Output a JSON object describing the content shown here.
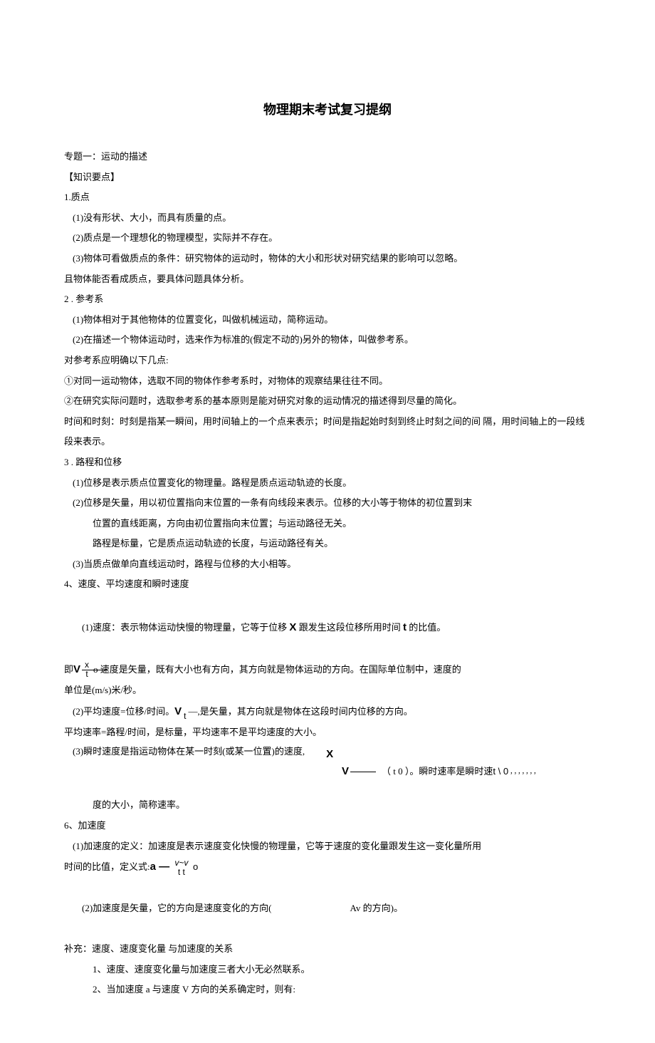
{
  "title": "物理期末考试复习提纲",
  "lines": {
    "l01": "专题一：运动的描述",
    "l02": "【知识要点】",
    "l03": "1.质点",
    "l04": "(1)没有形状、大小，而具有质量的点。",
    "l05": "(2)质点是一个理想化的物理模型，实际并不存在。",
    "l06": "(3)物体可看做质点的条件：研究物体的运动时，物体的大小和形状对研究结果的影响可以忽略。",
    "l07": "且物体能否看成质点，要具体问题具体分析。",
    "l08": "2 . 参考系",
    "l09": "(1)物体相对于其他物体的位置变化，叫做机械运动，简称运动。",
    "l10": "(2)在描述一个物体运动时，选来作为标准的(假定不动的)另外的物体，叫做参考系。",
    "l11": "对参考系应明确以下几点:",
    "l12": "①对同一运动物体，选取不同的物体作参考系时，对物体的观察结果往往不同。",
    "l13": "②在研究实际问题时，选取参考系的基本原则是能对研究对象的运动情况的描述得到尽量的简化。",
    "l14": "时间和时刻：时刻是指某一瞬间，用时间轴上的一个点来表示；时间是指起始时刻到终止时刻之间的间 隔，用时间轴上的一段线段来表示。",
    "l15": "3 . 路程和位移",
    "l16": "(1)位移是表示质点位置变化的物理量。路程是质点运动轨迹的长度。",
    "l17": "(2)位移是矢量，用以初位置指向末位置的一条有向线段来表示。位移的大小等于物体的初位置到末",
    "l18": "位置的直线距离，方向由初位置指向末位置；与运动路径无关。",
    "l19": "路程是标量，它是质点运动轨迹的长度，与运动路径有关。",
    "l20": "(3)当质点做单向直线运动时，路程与位移的大小相等。",
    "l21": "4、速度、平均速度和瞬时速度",
    "l22a": "(1)速度：表示物体运动快慢的物理量，它等于位移 ",
    "l22b": " 跟发生这段位移所用时间 ",
    "l22c": " 的比值。",
    "X": "X",
    "t": "t",
    "l23a": "即 ",
    "l23b": "o 速度是矢量，既有大小也有方向，其方向就是物体运动的方向。在国际单位制中，速度的",
    "frac1num": "x",
    "frac1den": "t",
    "l24": "单位是(m/s)米/秒。",
    "l25a": "(2)平均速度=位移/时间。",
    "l25b": " —,是矢量，其方向就是物体在这段时间内位移的方向。",
    "l25den": "t",
    "l26": "平均速率=路程/时间，是标量，平均速率不是平均速度的大小。",
    "l27a": "(3)瞬时速度是指运动物体在某一时刻(或某一位置)的速度,",
    "l27x": "X",
    "l27b": "（ t 0 ）。瞬时速率是瞬时速 ",
    "l27c": " t \\ 0",
    "dots": "，，，，，，，",
    "l28": "度的大小，简称速率。",
    "l29": "6、加速度",
    "l30": "(1)加速度的定义：加速度是表示速度变化快慢的物理量，它等于速度的变化量跟发生这一变化量所用",
    "l31a": "时间的比值，定义式: ",
    "l31b": "a — ",
    "l31c": "v~v ",
    "l31d": "o",
    "l31den": "t t",
    "l32a": "(2)加速度是矢量，它的方向是速度变化的方向(",
    "l32b": "Av 的方向)。",
    "l33": "补充：速度、速度变化量 与加速度的关系",
    "l34": "1、速度、速度变化量与加速度三者大小无必然联系。",
    "l35": "2、当加速度 a 与速度 V 方向的关系确定时，则有:"
  }
}
